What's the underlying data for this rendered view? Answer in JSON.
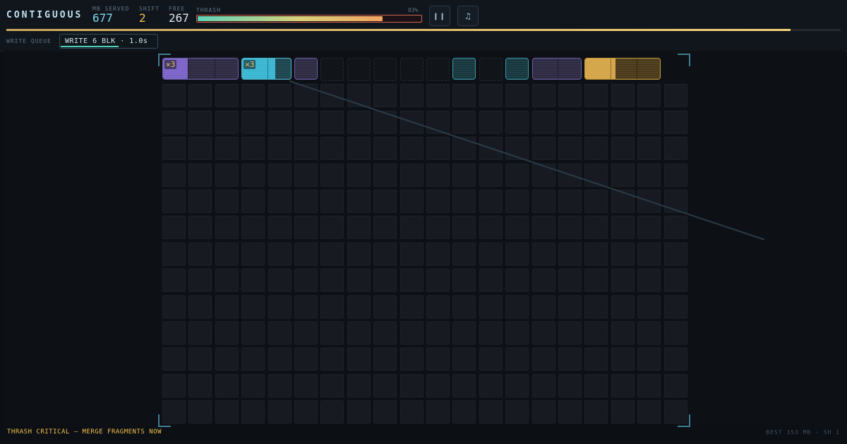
{
  "app": {
    "title": "CONTIGUOUS"
  },
  "stats": {
    "mb_served": {
      "label": "MB SERVED",
      "value": "677"
    },
    "shift": {
      "label": "SHIFT",
      "value": "2"
    },
    "free": {
      "label": "FREE",
      "value": "267"
    }
  },
  "thrash": {
    "label": "THRASH",
    "percent_text": "83%",
    "level": 0.83
  },
  "controls": {
    "pause_icon": "pause-icon",
    "music_icon": "music-note-icon"
  },
  "shift_progress": 0.94,
  "write_queue": {
    "label": "WRITE QUEUE",
    "item": "WRITE 6 BLK · 1.0s",
    "time_fraction": 0.6
  },
  "board": {
    "columns": 20,
    "rows": 14,
    "top_row": [
      {
        "type": "block",
        "color": "violet",
        "span": 3,
        "hot": 1,
        "mult": "×3"
      },
      {
        "type": "block",
        "color": "cyan-hot",
        "span": 2,
        "hot": 1.3,
        "mult": "×3"
      },
      {
        "type": "block",
        "color": "violet",
        "span": 1
      },
      {
        "type": "empty"
      },
      {
        "type": "empty"
      },
      {
        "type": "empty"
      },
      {
        "type": "empty"
      },
      {
        "type": "empty"
      },
      {
        "type": "block",
        "color": "teal",
        "span": 1
      },
      {
        "type": "empty"
      },
      {
        "type": "block",
        "color": "teal",
        "span": 1
      },
      {
        "type": "block",
        "color": "violet",
        "span": 2
      },
      {
        "type": "block",
        "color": "amber",
        "span": 3,
        "hot": 1.2
      }
    ]
  },
  "status": {
    "alert": "THRASH CRITICAL — MERGE FRAGMENTS NOW",
    "best": "BEST 353 MB · SH 1"
  },
  "colors": {
    "accent_cyan": "#7fd9ee",
    "accent_amber": "#f2c14e",
    "alert": "#f2c14e",
    "violet_block": "#7b63c8",
    "teal_block": "#3a97a8",
    "amber_block": "#d4a548"
  }
}
